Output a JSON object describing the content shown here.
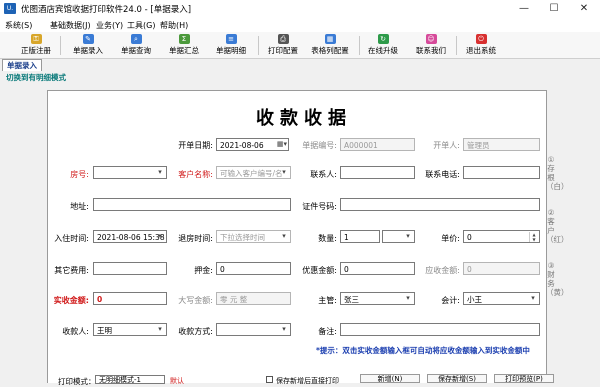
{
  "window": {
    "title": "优图酒店宾馆收据打印软件24.0 - [单据录入]",
    "icon_text": "U.",
    "controls": {
      "minimize": "—",
      "maximize": "☐",
      "close": "✕"
    }
  },
  "menu": [
    "系统(S)",
    "基础数据(J)",
    "业务(Y)",
    "工具(G)",
    "帮助(H)"
  ],
  "toolbar": [
    {
      "label": "正版注册",
      "icon": "key-icon",
      "color": "#d8a62a"
    },
    {
      "label": "单据录入",
      "icon": "document-edit-icon",
      "color": "#3a7bd5"
    },
    {
      "label": "单据查询",
      "icon": "search-icon",
      "color": "#3a7bd5"
    },
    {
      "label": "单据汇总",
      "icon": "summary-icon",
      "color": "#4c9a3c"
    },
    {
      "label": "单据明细",
      "icon": "list-icon",
      "color": "#3a7bd5"
    },
    {
      "label": "打印配置",
      "icon": "printer-icon",
      "color": "#555555"
    },
    {
      "label": "表格列配置",
      "icon": "table-icon",
      "color": "#3a7bd5"
    },
    {
      "label": "在线升级",
      "icon": "refresh-icon",
      "color": "#2e9b4a"
    },
    {
      "label": "联系我们",
      "icon": "contact-icon",
      "color": "#d64a9a"
    },
    {
      "label": "退出系统",
      "icon": "exit-icon",
      "color": "#d83030"
    }
  ],
  "tab": "单据录入",
  "switch_link": "切换到有明细模式",
  "form": {
    "title": "收款收据",
    "kai_dan_ri_qi": {
      "label": "开单日期:",
      "value": "2021-08-06"
    },
    "dan_ju_bian_hao": {
      "label": "单据编号:",
      "value": "A000001"
    },
    "kai_dan_ren": {
      "label": "开单人:",
      "value": "管理员"
    },
    "fang_hao": {
      "label": "房号:",
      "value": ""
    },
    "ke_hu_ming_cheng": {
      "label": "客户名称:",
      "placeholder": "可输入客户编号/名"
    },
    "lian_xi_ren": {
      "label": "联系人:",
      "value": ""
    },
    "lian_xi_dian_hua": {
      "label": "联系电话:",
      "value": ""
    },
    "di_zhi": {
      "label": "地址:",
      "value": ""
    },
    "zheng_jian_hao_ma": {
      "label": "证件号码:",
      "value": ""
    },
    "ru_zhu_shi_jian": {
      "label": "入住时间:",
      "value": "2021-08-06 15:38"
    },
    "tui_fang_shi_jian": {
      "label": "退房时间:",
      "placeholder": "下拉选择时间"
    },
    "shu_liang": {
      "label": "数量:",
      "value": "1"
    },
    "dan_jia": {
      "label": "单价:",
      "value": "0"
    },
    "qi_ta_fei_yong": {
      "label": "其它费用:",
      "value": ""
    },
    "ya_jin": {
      "label": "押金:",
      "value": "0"
    },
    "you_hui_jin_e": {
      "label": "优惠金额:",
      "value": "0"
    },
    "ying_shou_jin_e": {
      "label": "应收金额:",
      "value": "0"
    },
    "shi_shou_jin_e": {
      "label": "实收金额:",
      "value": "0"
    },
    "da_xie_jin_e": {
      "label": "大写金额:",
      "value": "零 元 整"
    },
    "zhu_guan": {
      "label": "主管:",
      "value": "张三"
    },
    "kuai_ji": {
      "label": "会计:",
      "value": "小王"
    },
    "shou_kuan_ren": {
      "label": "收款人:",
      "value": "王明"
    },
    "shou_kuan_fang_shi": {
      "label": "收款方式:",
      "value": ""
    },
    "bei_zhu": {
      "label": "备注:",
      "value": ""
    }
  },
  "hint": "*提示：双击实收金额输入框可自动将应收金额输入到实收金额中",
  "side_notes": [
    "①存根（白）",
    "②客户（红）",
    "③财务（黄）"
  ],
  "bottom": {
    "print_mode_label": "打印模式：",
    "print_mode_value": "无明细模式-1",
    "print_mode_tag": "默认",
    "checkbox_label": "保存新增后直接打印",
    "buttons": [
      "新增(N)",
      "保存新增(S)",
      "打印预览(P)"
    ]
  }
}
